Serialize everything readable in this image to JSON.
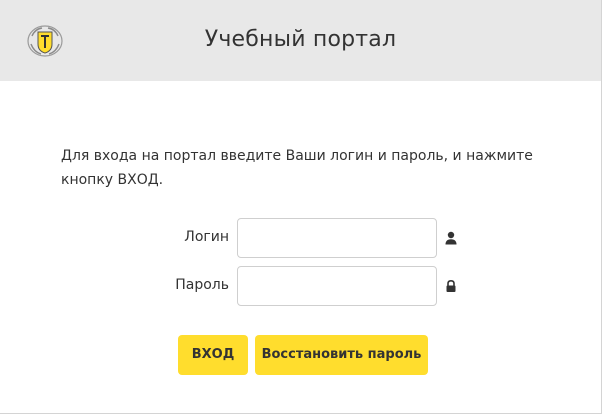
{
  "header": {
    "title": "Учебный портал",
    "logo_icon": "tinkoff-crest-icon"
  },
  "intro_text": "Для входа на портал введите Ваши логин и пароль, и нажмите кнопку ВХОД.",
  "form": {
    "login": {
      "label": "Логин",
      "value": "",
      "icon": "user-icon"
    },
    "password": {
      "label": "Пароль",
      "value": "",
      "icon": "lock-icon"
    }
  },
  "buttons": {
    "login_label": "ВХОД",
    "restore_label": "Восстановить пароль"
  },
  "colors": {
    "header_bg": "#e8e8e8",
    "accent": "#ffdd2d",
    "text": "#333333"
  }
}
